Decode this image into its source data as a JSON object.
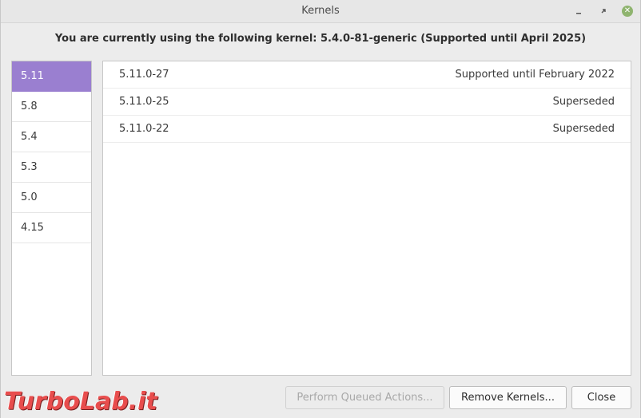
{
  "window": {
    "title": "Kernels",
    "controls": {
      "minimize": "minimize-icon",
      "maximize": "maximize-icon",
      "close": "close-icon"
    }
  },
  "header": {
    "text": "You are currently using the following kernel: 5.4.0-81-generic (Supported until April 2025)"
  },
  "sidebar": {
    "selected": 0,
    "items": [
      {
        "label": "5.11"
      },
      {
        "label": "5.8"
      },
      {
        "label": "5.4"
      },
      {
        "label": "5.3"
      },
      {
        "label": "5.0"
      },
      {
        "label": "4.15"
      }
    ]
  },
  "kernels": [
    {
      "version": "5.11.0-27",
      "status": "Supported until February 2022"
    },
    {
      "version": "5.11.0-25",
      "status": "Superseded"
    },
    {
      "version": "5.11.0-22",
      "status": "Superseded"
    }
  ],
  "buttons": {
    "queue": "Perform Queued Actions...",
    "remove": "Remove Kernels...",
    "close": "Close"
  },
  "watermark": "TurboLab.it",
  "colors": {
    "selection": "#9a7fd0",
    "close_button": "#8fb46f",
    "watermark": "#e84d4d"
  }
}
